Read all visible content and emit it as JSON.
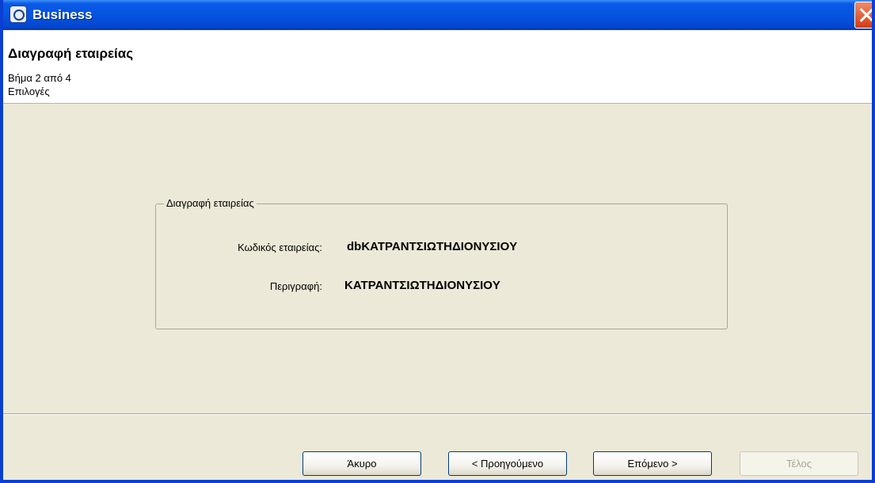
{
  "window": {
    "title": "Business"
  },
  "header": {
    "title": "Διαγραφή εταιρείας",
    "step": "Βήμα 2 από 4",
    "subtitle": "Επιλογές"
  },
  "group": {
    "label": "Διαγραφή εταιρείας",
    "fields": [
      {
        "label": "Κωδικός εταιρείας:",
        "value": "dbKATPANTΣIΩTHΔIONYΣIOY"
      },
      {
        "label": "Περιγραφή:",
        "value": "KATPANTΣIΩTHΔIONYΣIOY"
      }
    ]
  },
  "buttons": {
    "cancel": "Άκυρο",
    "previous": "< Προηγούμενο",
    "next": "Επόμενο >",
    "finish": "Τέλος"
  }
}
